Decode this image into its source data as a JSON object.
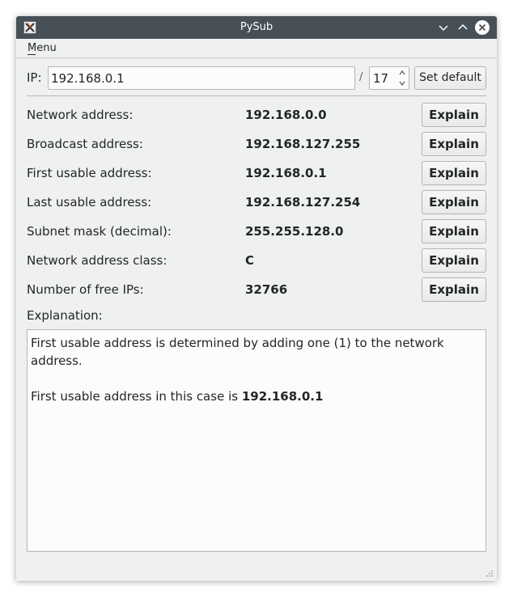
{
  "window": {
    "title": "PySub"
  },
  "menubar": {
    "menu_label": "Menu"
  },
  "ip_row": {
    "label": "IP:",
    "ip_value": "192.168.0.1",
    "slash": "/",
    "prefix_value": "17",
    "set_default_label": "Set default"
  },
  "results": [
    {
      "label": "Network address:",
      "value": "192.168.0.0",
      "button": "Explain"
    },
    {
      "label": "Broadcast address:",
      "value": "192.168.127.255",
      "button": "Explain"
    },
    {
      "label": "First usable address:",
      "value": "192.168.0.1",
      "button": "Explain"
    },
    {
      "label": "Last usable address:",
      "value": "192.168.127.254",
      "button": "Explain"
    },
    {
      "label": "Subnet mask (decimal):",
      "value": "255.255.128.0",
      "button": "Explain"
    },
    {
      "label": "Network address class:",
      "value": "C",
      "button": "Explain"
    },
    {
      "label": "Number of free IPs:",
      "value": "32766",
      "button": "Explain"
    }
  ],
  "explanation": {
    "label": "Explanation:",
    "paragraph1": "First usable address is determined by adding one (1) to the network address.",
    "paragraph2_prefix": "First usable address in this case is ",
    "paragraph2_value": "192.168.0.1"
  },
  "icons": {
    "app": "app-icon",
    "minimize": "chevron-down-icon",
    "maximize": "chevron-up-icon",
    "close": "close-icon",
    "spin_up": "arrow-up-icon",
    "spin_down": "arrow-down-icon",
    "resize": "resize-grip-icon"
  },
  "colors": {
    "titlebar": "#475057",
    "window_bg": "#eff0f1",
    "text": "#232627"
  }
}
